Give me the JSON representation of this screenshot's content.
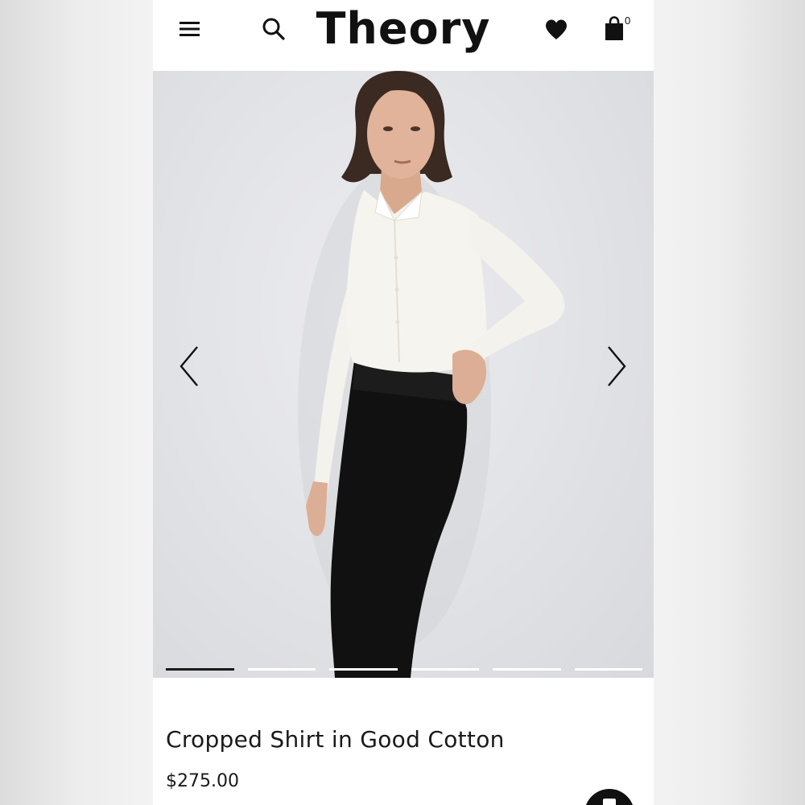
{
  "header": {
    "brand": "Theory",
    "bag_count": "0",
    "icons": {
      "menu": "hamburger-menu-icon",
      "search": "search-icon",
      "wishlist": "heart-icon",
      "bag": "shopping-bag-icon"
    }
  },
  "gallery": {
    "image": "Model wearing white cropped button-up shirt with black high-waisted trousers",
    "slides_total": 6,
    "active_slide": 1,
    "prev_icon": "chevron-left-icon",
    "next_icon": "chevron-right-icon"
  },
  "product": {
    "title": "Cropped Shirt in Good Cotton",
    "price": "$275.00"
  },
  "colors": {
    "text": "#1a1a1a",
    "background": "#ffffff",
    "gallery_bg": "#e3e4e8"
  }
}
